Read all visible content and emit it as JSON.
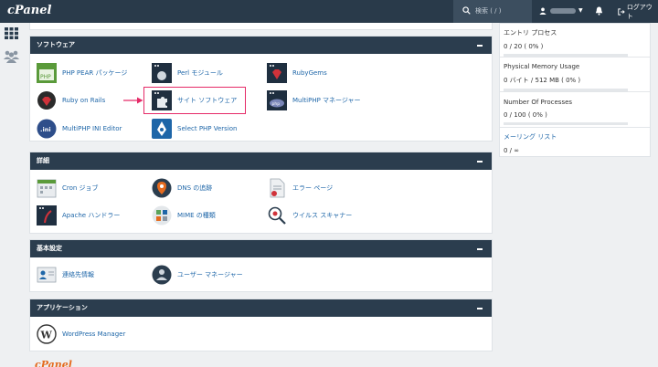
{
  "app": {
    "logo": "cPanel",
    "footer_logo": "cPanel"
  },
  "header": {
    "search_placeholder": "検索 ( / )",
    "logout_label": "ログアウト"
  },
  "sections": {
    "software": {
      "title": "ソフトウェア",
      "items": [
        {
          "label": "PHP PEAR パッケージ",
          "icon": "php-pear-icon"
        },
        {
          "label": "Perl モジュール",
          "icon": "perl-icon"
        },
        {
          "label": "RubyGems",
          "icon": "rubygems-icon"
        },
        {
          "label": "Ruby on Rails",
          "icon": "ruby-on-rails-icon"
        },
        {
          "label": "サイト ソフトウェア",
          "icon": "puzzle-icon"
        },
        {
          "label": "MultiPHP マネージャー",
          "icon": "php-icon"
        },
        {
          "label": "MultiPHP INI Editor",
          "icon": "ini-icon"
        },
        {
          "label": "Select PHP Version",
          "icon": "php-version-icon"
        }
      ]
    },
    "advanced": {
      "title": "詳細",
      "items": [
        {
          "label": "Cron ジョブ",
          "icon": "calendar-icon"
        },
        {
          "label": "DNS の追跡",
          "icon": "dns-pin-icon"
        },
        {
          "label": "エラー ページ",
          "icon": "error-page-icon"
        },
        {
          "label": "Apache ハンドラー",
          "icon": "apache-icon"
        },
        {
          "label": "MIME の種類",
          "icon": "mime-icon"
        },
        {
          "label": "ウイルス スキャナー",
          "icon": "virus-scanner-icon"
        }
      ]
    },
    "preferences": {
      "title": "基本設定",
      "items": [
        {
          "label": "連絡先情報",
          "icon": "contact-card-icon"
        },
        {
          "label": "ユーザー マネージャー",
          "icon": "user-manager-icon"
        }
      ]
    },
    "applications": {
      "title": "アプリケーション",
      "items": [
        {
          "label": "WordPress Manager",
          "icon": "wordpress-icon"
        }
      ]
    }
  },
  "stats": {
    "entry_processes": {
      "label": "エントリ プロセス",
      "value": "0 / 20 ( 0% )",
      "fraction": 0
    },
    "physical_memory": {
      "label": "Physical Memory Usage",
      "value": "0 バイト / 512 MB ( 0% )",
      "fraction": 0
    },
    "processes": {
      "label": "Number Of Processes",
      "value": "0 / 100 ( 0% )",
      "fraction": 0
    },
    "mailing_lists": {
      "label": "メーリング リスト",
      "value": "0 / ∞"
    }
  },
  "colors": {
    "topbar": "#293a4a",
    "panel_header": "#2b3d4e",
    "link": "#1e66a8",
    "highlight": "#e52a67"
  }
}
